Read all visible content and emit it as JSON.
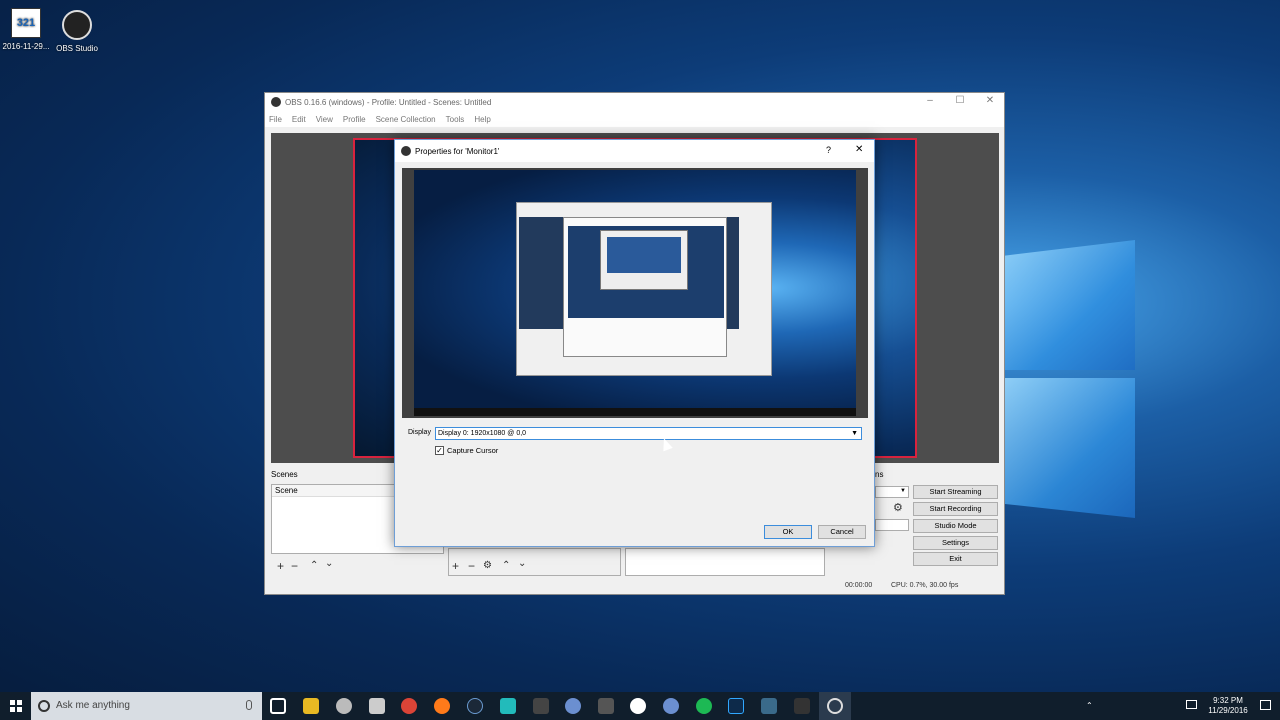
{
  "desktop": {
    "icons": [
      {
        "label": "2016-11-29...",
        "badge": "321"
      },
      {
        "label": "OBS Studio"
      }
    ]
  },
  "obs": {
    "title": "OBS 0.16.6 (windows) - Profile: Untitled - Scenes: Untitled",
    "menu": [
      "File",
      "Edit",
      "View",
      "Profile",
      "Scene Collection",
      "Tools",
      "Help"
    ],
    "scenes_title": "Scenes",
    "scenes_header": "Scene",
    "controls_title_fragment": "ns",
    "buttons": {
      "start_streaming": "Start Streaming",
      "start_recording": "Start Recording",
      "studio_mode": "Studio Mode",
      "settings": "Settings",
      "exit": "Exit"
    },
    "status": {
      "time": "00:00:00",
      "cpu": "CPU: 0.7%, 30.00 fps"
    }
  },
  "dialog": {
    "title": "Properties for 'Monitor1'",
    "help": "?",
    "display_label": "Display",
    "display_value": "Display 0: 1920x1080 @ 0,0",
    "capture_cursor_label": "Capture Cursor",
    "capture_cursor_checked": true,
    "ok": "OK",
    "cancel": "Cancel"
  },
  "taskbar": {
    "search_placeholder": "Ask me anything",
    "time": "9:32 PM",
    "date": "11/29/2016"
  },
  "colors": {
    "preview_border": "#d8233e",
    "taskbar": "#101e2c",
    "dialog_border": "#6e9ed6"
  }
}
